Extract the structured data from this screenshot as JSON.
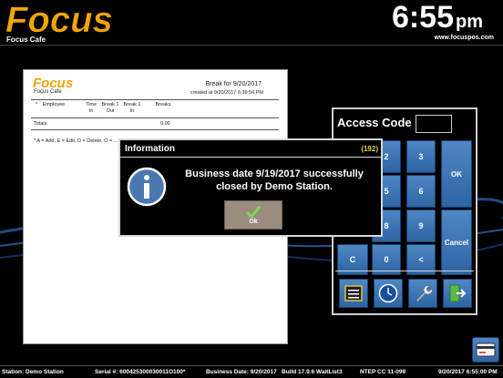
{
  "header": {
    "logo_text": "Focus",
    "site_name": "Focus Cafe",
    "time": "6:55",
    "ampm": "pm",
    "url": "www.focuspos.com"
  },
  "report": {
    "logo_text": "Focus",
    "site_name": "Focus Cafe",
    "title": "Break for 9/20/2017",
    "subtitle": "created at 9/20/2017 6:39:56 PM",
    "columns": [
      {
        "line1": "",
        "line2": "*"
      },
      {
        "line1": "",
        "line2": "Employee"
      },
      {
        "line1": "Time",
        "line2": "In"
      },
      {
        "line1": "Break 1",
        "line2": "Out"
      },
      {
        "line1": "Break 1",
        "line2": "In"
      },
      {
        "line1": "",
        "line2": "Breaks"
      }
    ],
    "totals_label": "Totals",
    "totals_value": "0.00",
    "legend": "* A = Add, E = Edit, D = Delete, O = ..."
  },
  "keypad": {
    "title": "Access Code",
    "keys": [
      "2",
      "3",
      "OK",
      "5",
      "6",
      "8",
      "9",
      "Cancel",
      "C",
      "0",
      "<"
    ],
    "tools": [
      "register-icon",
      "clock-icon",
      "wrench-icon",
      "exit-icon"
    ]
  },
  "dialog": {
    "title": "Information",
    "code": "(192)",
    "message_line1": "Business date 9/19/2017 successfully",
    "message_line2": "closed by Demo Station.",
    "ok_label": "Ok"
  },
  "status": {
    "station": "Station: Demo Station",
    "serial": "Serial #: 600425300030011O100*",
    "business_date": "Business Date: 9/20/2017",
    "build": "Build 17.9.6 WaitList3",
    "ntep": "NTEP CC 11-099",
    "datetime": "9/20/2017 6:55:00 PM"
  },
  "colors": {
    "logo": "#f0a500",
    "key_blue": "#3d74b3",
    "code_yellow": "#e6d24a",
    "ok_button": "#9b8c80",
    "check_green": "#7ed957"
  }
}
